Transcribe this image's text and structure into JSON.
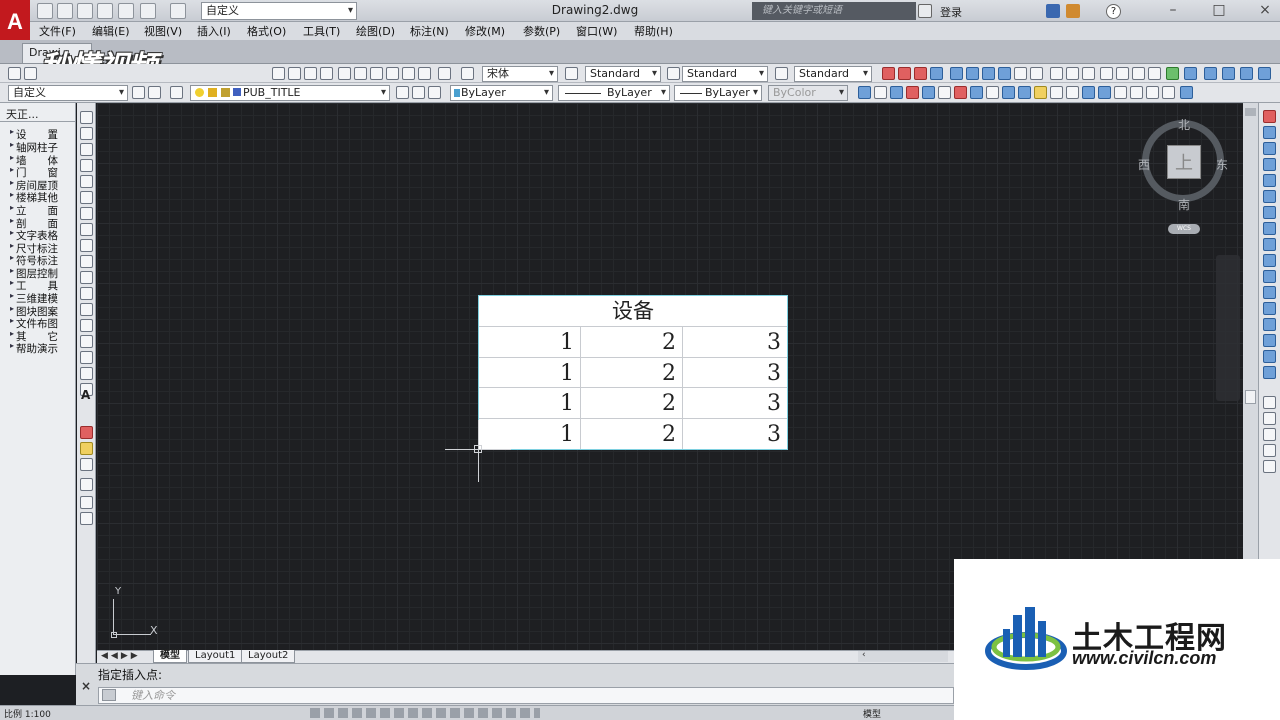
{
  "app": {
    "logo_letter": "A",
    "document_title": "Drawing2.dwg",
    "doc_tab": "Drawi..."
  },
  "workspace": {
    "selected": "自定义"
  },
  "search": {
    "placeholder": "键入关键字或短语"
  },
  "account": {
    "login": "登录"
  },
  "menu": [
    "文件(F)",
    "编辑(E)",
    "视图(V)",
    "插入(I)",
    "格式(O)",
    "工具(T)",
    "绘图(D)",
    "标注(N)",
    "修改(M)",
    "参数(P)",
    "窗口(W)",
    "帮助(H)"
  ],
  "toolbar1": {
    "font": "宋体",
    "text_style": "Standard",
    "dim_style": "Standard",
    "multileader_style": "Standard"
  },
  "toolbar2": {
    "ucs": "自定义",
    "layer": "PUB_TITLE",
    "color": "ByLayer",
    "linetype": "ByLayer",
    "lineweight": "ByLayer",
    "plotstyle": "ByColor"
  },
  "tianzheng": {
    "title": "天正...",
    "items": [
      "设　　置",
      "轴网柱子",
      "墙　　体",
      "门　　窗",
      "房间屋顶",
      "楼梯其他",
      "立　　面",
      "剖　　面",
      "文字表格",
      "尺寸标注",
      "符号标注",
      "图层控制",
      "工　　具",
      "三维建模",
      "图块图案",
      "文件布图",
      "其　　它",
      "帮助演示"
    ]
  },
  "viewcube": {
    "north": "北",
    "south": "南",
    "east": "东",
    "west": "西",
    "face": "上",
    "wcs": "WCS"
  },
  "table": {
    "title": "设备",
    "rows": [
      [
        "1",
        "2",
        "3"
      ],
      [
        "1",
        "2",
        "3"
      ],
      [
        "1",
        "2",
        "3"
      ],
      [
        "1",
        "2",
        "3"
      ]
    ]
  },
  "ucs": {
    "x_label": "X",
    "y_label": "Y"
  },
  "layout_tabs": [
    "模型",
    "Layout1",
    "Layout2"
  ],
  "command": {
    "history": "指定插入点:",
    "placeholder": "键入命令"
  },
  "status": {
    "scale": "比例 1:100",
    "model": "模型"
  },
  "watermarks": {
    "top_logo": "秒懂视频",
    "civil_cn": "土木工程网",
    "civil_url": "www.civilcn.com"
  }
}
